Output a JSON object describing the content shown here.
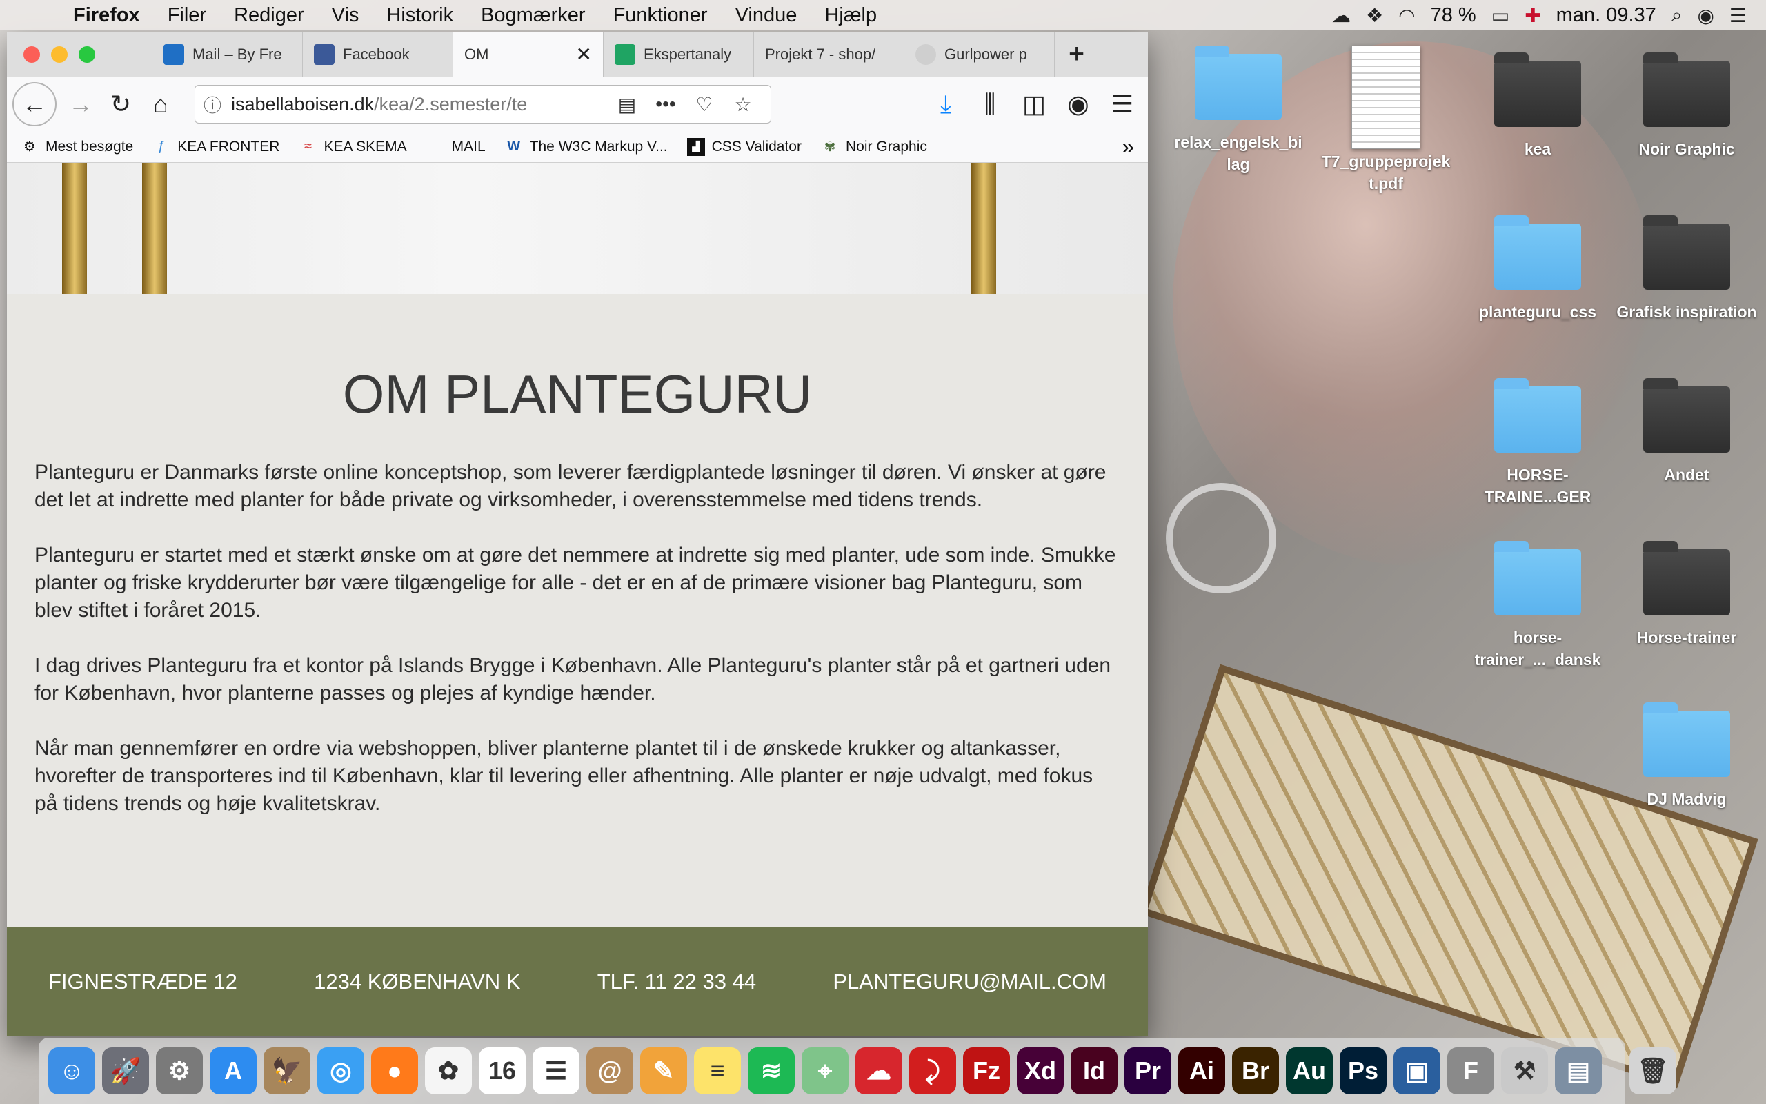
{
  "menubar": {
    "app_name": "Firefox",
    "menus": [
      "Filer",
      "Rediger",
      "Vis",
      "Historik",
      "Bogmærker",
      "Funktioner",
      "Vindue",
      "Hjælp"
    ],
    "battery": "78 %",
    "clock": "man. 09.37"
  },
  "desktop": {
    "items": [
      {
        "label": "relax_engelsk_bi lag",
        "type": "folder"
      },
      {
        "label": "T7_gruppeprojek t.pdf",
        "type": "pdf"
      },
      {
        "label": "kea",
        "type": "folder-dark"
      },
      {
        "label": "Noir Graphic",
        "type": "folder-dark"
      },
      {
        "label": "planteguru_css",
        "type": "folder"
      },
      {
        "label": "Grafisk inspiration",
        "type": "folder-dark"
      },
      {
        "label": "HORSE-TRAINE...GER",
        "type": "folder"
      },
      {
        "label": "Andet",
        "type": "folder-dark"
      },
      {
        "label": "horse-trainer_..._dansk",
        "type": "folder"
      },
      {
        "label": "Horse-trainer",
        "type": "folder-dark"
      },
      {
        "label": "DJ Madvig",
        "type": "folder"
      }
    ]
  },
  "browser": {
    "tabs": [
      {
        "label": "Mail – By Fre",
        "color": "#1f6fc5"
      },
      {
        "label": "Facebook",
        "color": "#3b5998"
      },
      {
        "label": "OM",
        "active": true
      },
      {
        "label": "Ekspertanaly",
        "color": "#1fa463"
      },
      {
        "label": "Projekt 7 - shop/",
        "color": ""
      },
      {
        "label": "Gurlpower p",
        "color": "#888888"
      }
    ],
    "url_host": "isabellaboisen.dk",
    "url_path": "/kea/2.semester/te",
    "bookmarks": [
      {
        "label": "Mest besøgte",
        "icon": "gear-icon"
      },
      {
        "label": "KEA FRONTER",
        "icon": "kea-icon"
      },
      {
        "label": "KEA SKEMA",
        "icon": "kea-skema-icon"
      },
      {
        "label": "MAIL",
        "icon": "microsoft-icon"
      },
      {
        "label": "The W3C Markup V...",
        "icon": "w3c-icon"
      },
      {
        "label": "CSS Validator",
        "icon": "css-icon"
      },
      {
        "label": "Noir Graphic",
        "icon": "noir-icon"
      }
    ]
  },
  "page": {
    "title": "OM PLANTEGURU",
    "paragraphs": [
      "Planteguru er Danmarks første online konceptshop, som leverer færdigplantede løsninger til døren. Vi ønsker at gøre det let at indrette med planter for både private og virksomheder, i overensstemmelse med tidens trends.",
      "Planteguru er startet med et stærkt ønske om at gøre det nemmere at indrette sig med planter, ude som inde. Smukke planter og friske krydderurter bør være tilgængelige for alle - det er en af de primære visioner bag Planteguru, som blev stiftet i foråret 2015.",
      "I dag drives Planteguru fra et kontor på Islands Brygge i København. Alle Planteguru's planter står på et gartneri uden for København, hvor planterne passes og plejes af kyndige hænder.",
      "Når man gennemfører en ordre via webshoppen, bliver planterne plantet til i de ønskede krukker og altankasser, hvorefter de transporteres ind til København, klar til levering eller afhentning. Alle planter er nøje udvalgt, med fokus på tidens trends og høje kvalitetskrav."
    ],
    "footer": {
      "address": "FIGNESTRÆDE 12",
      "city": "1234 KØBENHAVN K",
      "phone": "TLF. 11 22 33 44",
      "email": "PLANTEGURU@MAIL.COM"
    }
  },
  "dock": {
    "apps": [
      {
        "name": "finder",
        "color": "#3d8fe6",
        "glyph": "☺"
      },
      {
        "name": "launchpad",
        "color": "#6d6f78",
        "glyph": "🚀"
      },
      {
        "name": "system-preferences",
        "color": "#7a7a7a",
        "glyph": "⚙"
      },
      {
        "name": "app-store",
        "color": "#2d8cf0",
        "glyph": "A"
      },
      {
        "name": "preview",
        "color": "#a7865b",
        "glyph": "🦅"
      },
      {
        "name": "safari",
        "color": "#3aa0f3",
        "glyph": "◎"
      },
      {
        "name": "firefox",
        "color": "#ff7a1a",
        "glyph": "●"
      },
      {
        "name": "photos",
        "color": "#f5f5f5",
        "glyph": "✿"
      },
      {
        "name": "calendar",
        "color": "#ffffff",
        "glyph": "16"
      },
      {
        "name": "reminders",
        "color": "#ffffff",
        "glyph": "☰"
      },
      {
        "name": "contacts",
        "color": "#b48a5a",
        "glyph": "@"
      },
      {
        "name": "pages",
        "color": "#f1a33a",
        "glyph": "✎"
      },
      {
        "name": "notes",
        "color": "#fde36a",
        "glyph": "≡"
      },
      {
        "name": "spotify",
        "color": "#1db954",
        "glyph": "≋"
      },
      {
        "name": "maps",
        "color": "#7fc48a",
        "glyph": "⌖"
      },
      {
        "name": "creative-cloud",
        "color": "#d7262d",
        "glyph": "☁"
      },
      {
        "name": "acrobat",
        "color": "#d21e1e",
        "glyph": "⤸"
      },
      {
        "name": "filezilla",
        "color": "#bf1313",
        "glyph": "Fz"
      },
      {
        "name": "xd",
        "color": "#470137",
        "glyph": "Xd"
      },
      {
        "name": "indesign",
        "color": "#49021f",
        "glyph": "Id"
      },
      {
        "name": "premiere",
        "color": "#2a003f",
        "glyph": "Pr"
      },
      {
        "name": "illustrator",
        "color": "#330000",
        "glyph": "Ai"
      },
      {
        "name": "bridge",
        "color": "#3a2300",
        "glyph": "Br"
      },
      {
        "name": "audition",
        "color": "#00372f",
        "glyph": "Au"
      },
      {
        "name": "photoshop",
        "color": "#001e36",
        "glyph": "Ps"
      },
      {
        "name": "window-app",
        "color": "#2a5f9e",
        "glyph": "▣"
      },
      {
        "name": "font-book",
        "color": "#8a8a8a",
        "glyph": "F"
      },
      {
        "name": "xcode-tools",
        "color": "#c9c9c9",
        "glyph": "⚒"
      },
      {
        "name": "image-capture",
        "color": "#7d8fa3",
        "glyph": "▤"
      },
      {
        "name": "trash",
        "color": "#d4d4d4",
        "glyph": "🗑"
      }
    ]
  }
}
